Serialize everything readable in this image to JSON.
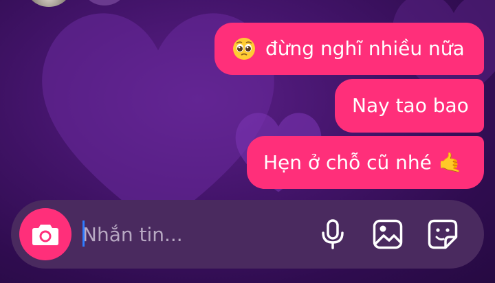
{
  "conversation": {
    "messages": [
      {
        "text": "đừng nghĩ nhiều nữa",
        "leading_icon": "pleading-face-emoji"
      },
      {
        "text": "Nay tao bao"
      },
      {
        "text": "Hẹn ở chỗ cũ nhé",
        "trailing_emoji": "🤙"
      }
    ]
  },
  "composer": {
    "placeholder": "Nhắn tin...",
    "value": ""
  },
  "icons": {
    "camera": "camera-icon",
    "microphone": "microphone-icon",
    "gallery": "image-icon",
    "sticker": "sticker-icon"
  },
  "colors": {
    "bubble": "#ff2f7a",
    "background": "#43146a",
    "composer": "#4a2a5f",
    "caret": "#2e7bff"
  }
}
